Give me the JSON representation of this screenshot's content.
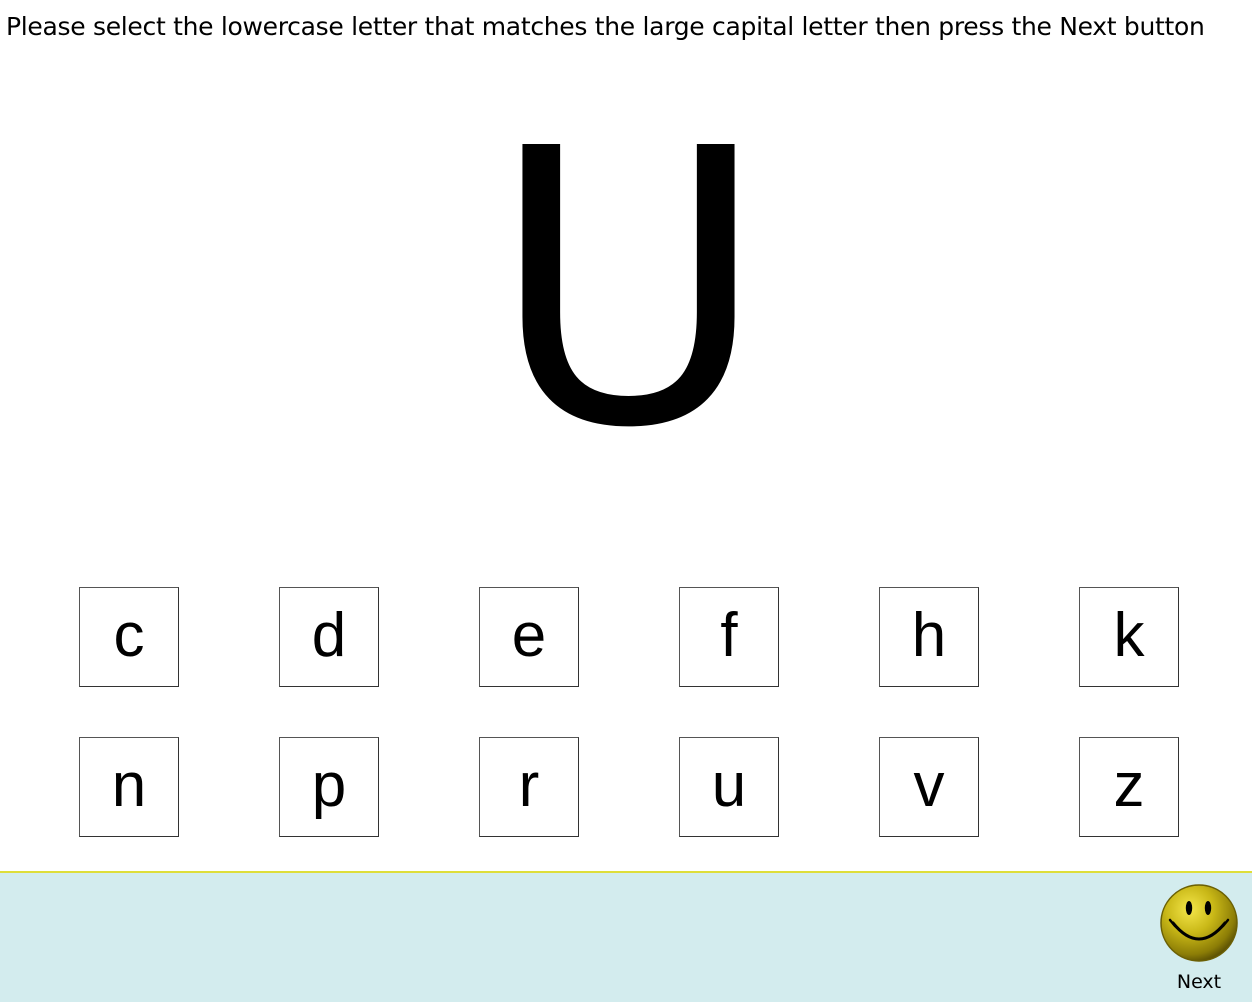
{
  "instruction": "Please select the lowercase letter that matches the large capital letter then press the Next button",
  "target_letter": "U",
  "choices": [
    "c",
    "d",
    "e",
    "f",
    "h",
    "k",
    "n",
    "p",
    "r",
    "u",
    "v",
    "z"
  ],
  "next": {
    "label": "Next",
    "icon": "smiley-face-icon"
  },
  "colors": {
    "footer_background": "#d3ecee",
    "footer_border": "#dede3a",
    "smiley_face": "#b8a812"
  }
}
